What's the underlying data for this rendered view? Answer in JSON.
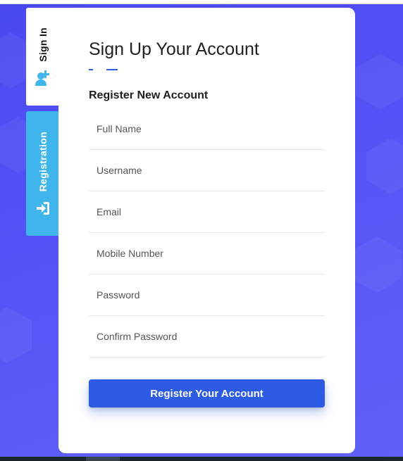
{
  "tabs": {
    "signin": {
      "label": "Sign In",
      "icon": "user-plus-icon",
      "color": "#3fb5ec"
    },
    "registration": {
      "label": "Registration",
      "icon": "sign-in-arrow-icon",
      "background": "#3fb5ec"
    }
  },
  "form": {
    "title": "Sign Up Your Account",
    "subtitle": "Register New Account",
    "fields": {
      "full_name": {
        "placeholder": "Full Name"
      },
      "username": {
        "placeholder": "Username"
      },
      "email": {
        "placeholder": "Email"
      },
      "mobile": {
        "placeholder": "Mobile Number"
      },
      "password": {
        "placeholder": "Password"
      },
      "confirm_password": {
        "placeholder": "Confirm Password"
      }
    },
    "submit_label": "Register Your Account"
  },
  "colors": {
    "background_gradient": [
      "#4a49f2",
      "#6061f7"
    ],
    "accent": "#2d5be3",
    "tab_active": "#ffffff",
    "tab_inactive": "#3fb5ec"
  }
}
